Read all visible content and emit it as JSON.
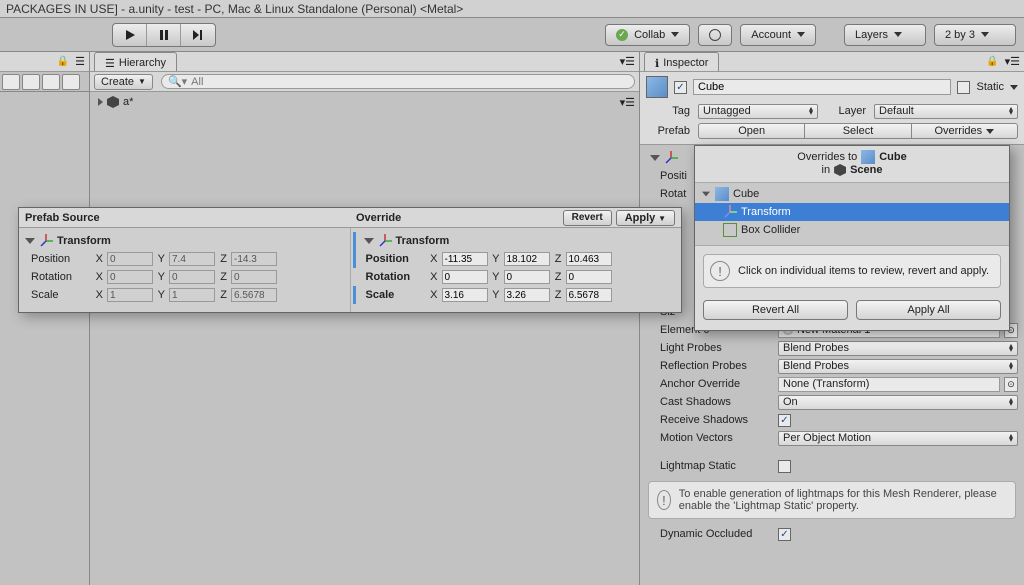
{
  "window_title": "PACKAGES IN USE] - a.unity - test - PC, Mac & Linux Standalone (Personal) <Metal>",
  "toolbar": {
    "collab": "Collab",
    "account": "Account",
    "layers": "Layers",
    "layout": "2 by 3"
  },
  "hierarchy": {
    "tab": "Hierarchy",
    "create": "Create",
    "search_placeholder": "All",
    "root": "a*"
  },
  "inspector": {
    "tab": "Inspector",
    "name": "Cube",
    "static_label": "Static",
    "tag_label": "Tag",
    "tag_value": "Untagged",
    "layer_label": "Layer",
    "layer_value": "Default",
    "prefab_label": "Prefab",
    "btn_open": "Open",
    "btn_select": "Select",
    "btn_overrides": "Overrides",
    "position_label_trunc": "Positi",
    "rotation_label_trunc": "Rotat",
    "size_label_trunc": "Siz",
    "element0_label": "Element 0",
    "element0_value": "New Material 1",
    "light_probes_label": "Light Probes",
    "light_probes_value": "Blend Probes",
    "refl_probes_label": "Reflection Probes",
    "refl_probes_value": "Blend Probes",
    "anchor_label": "Anchor Override",
    "anchor_value": "None (Transform)",
    "cast_shadows_label": "Cast Shadows",
    "cast_shadows_value": "On",
    "recv_shadows_label": "Receive Shadows",
    "recv_shadows_checked": true,
    "motion_label": "Motion Vectors",
    "motion_value": "Per Object Motion",
    "lightmap_static_label": "Lightmap Static",
    "lightmap_info": "To enable generation of lightmaps for this Mesh Renderer, please enable the 'Lightmap Static' property.",
    "dynamic_occluded_label": "Dynamic Occluded",
    "dynamic_occluded_checked": true
  },
  "prefab_compare": {
    "source_title": "Prefab Source",
    "override_title": "Override",
    "revert": "Revert",
    "apply": "Apply",
    "component": "Transform",
    "rows": [
      "Position",
      "Rotation",
      "Scale"
    ],
    "source": {
      "position": {
        "x": "0",
        "y": "7.4",
        "z": "-14.3"
      },
      "rotation": {
        "x": "0",
        "y": "0",
        "z": "0"
      },
      "scale": {
        "x": "1",
        "y": "1",
        "z": "6.5678"
      }
    },
    "override": {
      "position": {
        "x": "-11.35",
        "y": "18.102",
        "z": "10.463"
      },
      "rotation": {
        "x": "0",
        "y": "0",
        "z": "0"
      },
      "scale": {
        "x": "3.16",
        "y": "3.26",
        "z": "6.5678"
      }
    }
  },
  "overrides_popup": {
    "title_prefix": "Overrides to",
    "title_target": "Cube",
    "in_prefix": "in",
    "in_target": "Scene",
    "tree_root": "Cube",
    "tree_items": [
      "Transform",
      "Box Collider"
    ],
    "info": "Click on individual items to review, revert and apply.",
    "revert_all": "Revert All",
    "apply_all": "Apply All"
  }
}
